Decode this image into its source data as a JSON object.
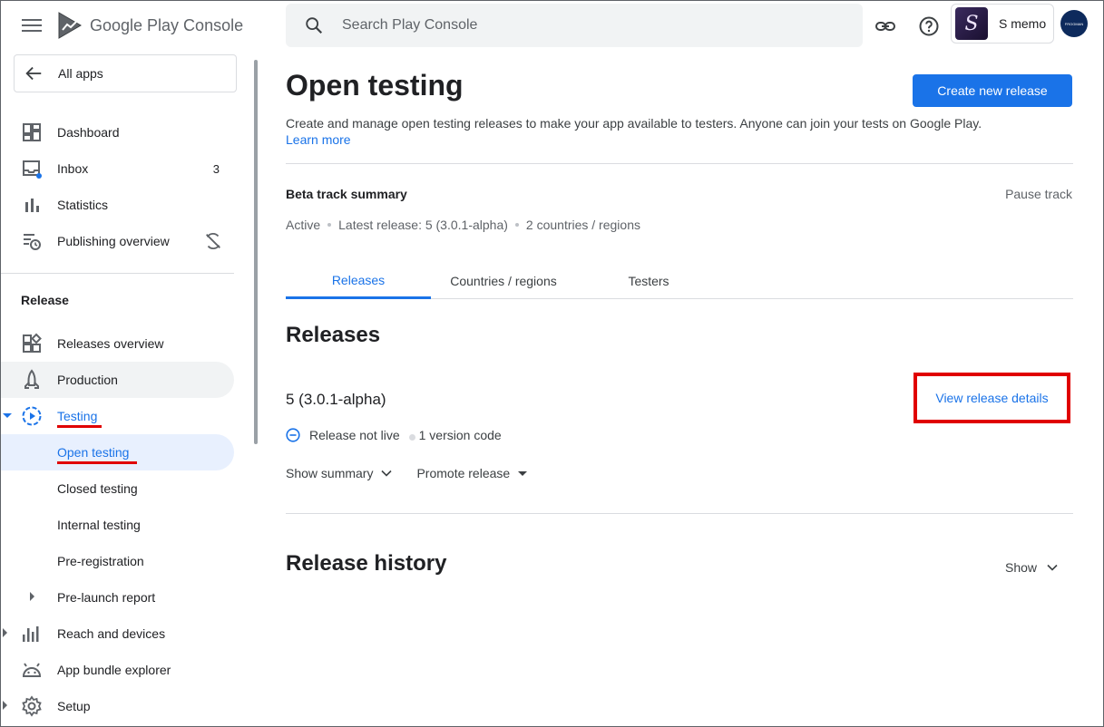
{
  "header": {
    "product_name": "Google Play Console",
    "search_placeholder": "Search Play Console",
    "app_name": "S memo",
    "app_initial": "S",
    "account_label": "FROGMAN"
  },
  "sidebar": {
    "all_apps": "All apps",
    "items": [
      {
        "label": "Dashboard",
        "icon": "dashboard-icon"
      },
      {
        "label": "Inbox",
        "icon": "inbox-icon",
        "count": "3"
      },
      {
        "label": "Statistics",
        "icon": "bar-chart-icon"
      },
      {
        "label": "Publishing overview",
        "icon": "publishing-overview-icon"
      }
    ],
    "section_release": "Release",
    "release_items": [
      {
        "label": "Releases overview",
        "icon": "releases-overview-icon"
      },
      {
        "label": "Production",
        "icon": "production-icon"
      },
      {
        "label": "Testing",
        "icon": "testing-icon"
      },
      {
        "label": "Open testing"
      },
      {
        "label": "Closed testing"
      },
      {
        "label": "Internal testing"
      },
      {
        "label": "Pre-registration"
      },
      {
        "label": "Pre-launch report"
      },
      {
        "label": "Reach and devices",
        "icon": "reach-devices-icon"
      },
      {
        "label": "App bundle explorer",
        "icon": "android-icon"
      },
      {
        "label": "Setup",
        "icon": "gear-icon"
      }
    ]
  },
  "main": {
    "title": "Open testing",
    "create_button": "Create new release",
    "description": "Create and manage open testing releases to make your app available to testers. Anyone can join your tests on Google Play.",
    "learn_more": "Learn more",
    "summary_title": "Beta track summary",
    "pause_track": "Pause track",
    "meta": {
      "status": "Active",
      "latest_release": "Latest release: 5 (3.0.1-alpha)",
      "countries": "2 countries / regions"
    },
    "tabs": [
      "Releases",
      "Countries / regions",
      "Testers"
    ],
    "active_tab": "Releases",
    "releases_heading": "Releases",
    "release": {
      "name": "5 (3.0.1-alpha)",
      "view_details": "View release details",
      "status": "Release not live",
      "version_codes": "1 version code",
      "show_summary": "Show summary",
      "promote": "Promote release"
    },
    "history_heading": "Release history",
    "history_show": "Show"
  },
  "colors": {
    "accent": "#1a73e8",
    "highlight_annotation": "#e00000"
  }
}
